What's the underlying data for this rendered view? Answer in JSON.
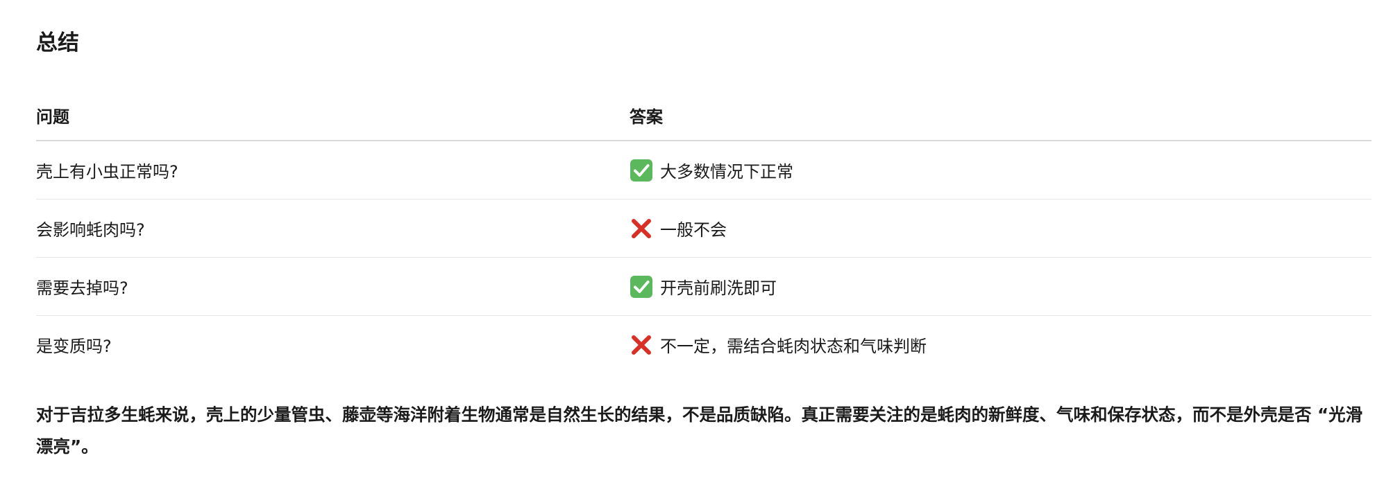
{
  "heading": "总结",
  "table": {
    "header": {
      "question": "问题",
      "answer": "答案"
    },
    "rows": [
      {
        "question": "壳上有小虫正常吗?",
        "mark": "check-icon",
        "answer": "大多数情况下正常"
      },
      {
        "question": "会影响蚝肉吗?",
        "mark": "cross-icon",
        "answer": "一般不会"
      },
      {
        "question": "需要去掉吗?",
        "mark": "check-icon",
        "answer": "开壳前刷洗即可"
      },
      {
        "question": "是变质吗?",
        "mark": "cross-icon",
        "answer": "不一定，需结合蚝肉状态和气味判断"
      }
    ]
  },
  "conclusion": "对于吉拉多生蚝来说，壳上的少量管虫、藤壶等海洋附着生物通常是自然生长的结果，不是品质缺陷。真正需要关注的是蚝肉的新鲜度、气味和保存状态，而不是外壳是否 “光滑漂亮”。",
  "colors": {
    "check_bg": "#5cb85c",
    "cross": "#d93025",
    "text": "#1a1a1a",
    "divider": "#e6e6e6"
  }
}
